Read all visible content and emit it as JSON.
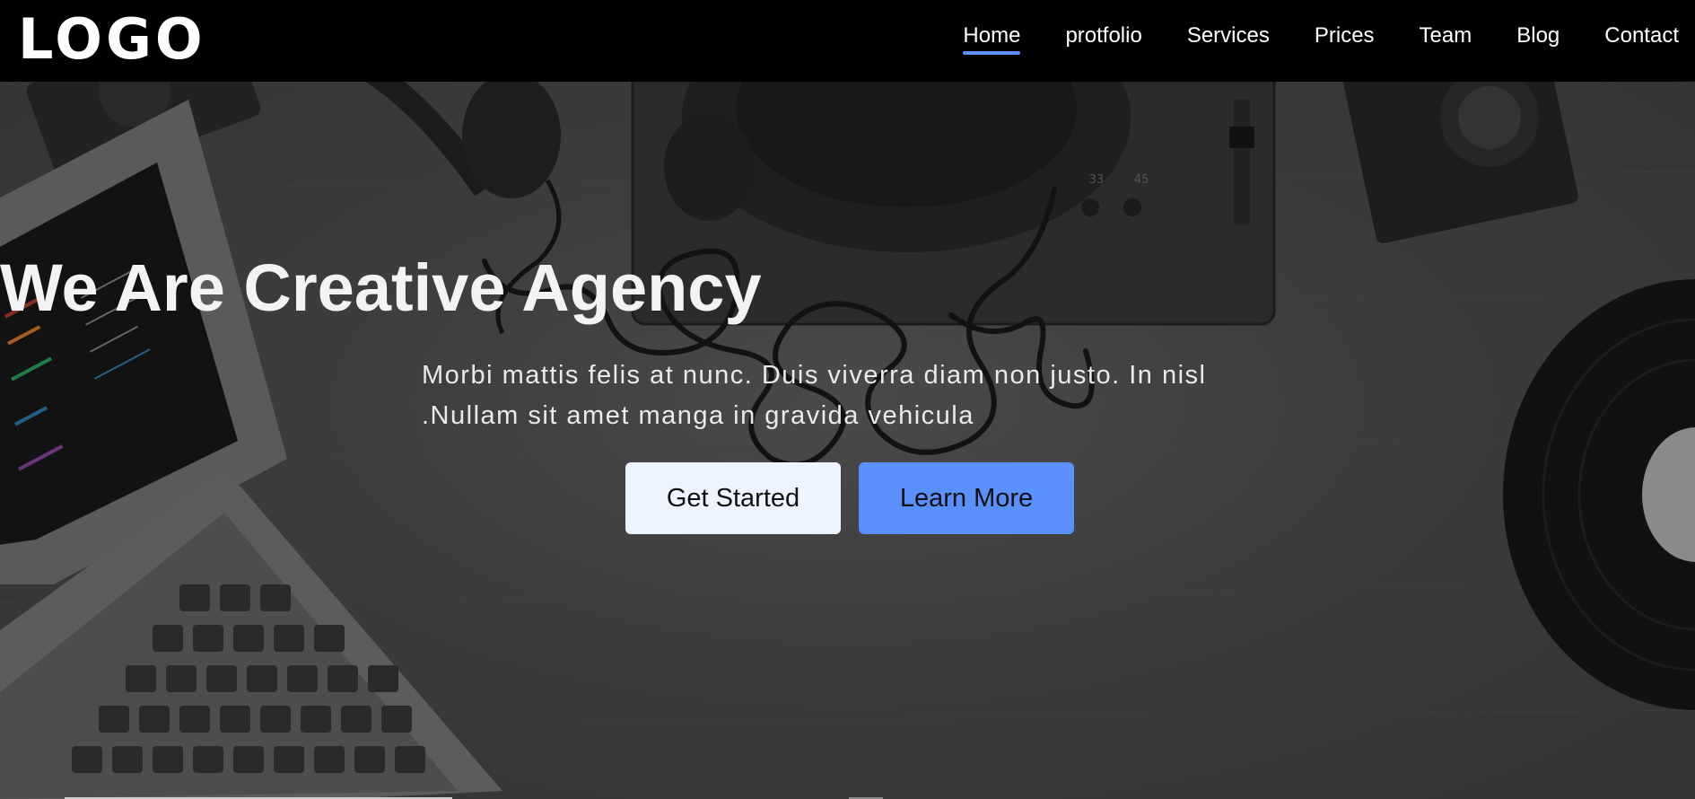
{
  "header": {
    "logo": "LOGO",
    "nav": [
      {
        "label": "Home",
        "active": true
      },
      {
        "label": "protfolio",
        "active": false
      },
      {
        "label": "Services",
        "active": false
      },
      {
        "label": "Prices",
        "active": false
      },
      {
        "label": "Team",
        "active": false
      },
      {
        "label": "Blog",
        "active": false
      },
      {
        "label": "Contact",
        "active": false
      }
    ]
  },
  "hero": {
    "title": "We Are Creative Agency",
    "text": "Morbi mattis felis at nunc. Duis viverra diam non justo. In nisl .Nullam sit amet manga in gravida vehicula",
    "primary_button": "Get Started",
    "secondary_button": "Learn More",
    "turntable_labels": [
      "33",
      "45"
    ]
  },
  "colors": {
    "accent": "#5b8ff9",
    "primary_button_bg": "#eef4ff",
    "nav_bg": "#000000"
  }
}
